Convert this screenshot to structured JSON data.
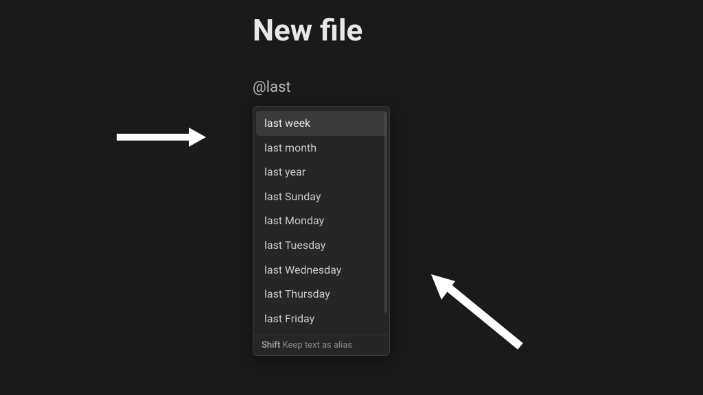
{
  "title": "New file",
  "query": "@last",
  "suggestions": [
    {
      "label": "last week",
      "selected": true
    },
    {
      "label": "last month",
      "selected": false
    },
    {
      "label": "last year",
      "selected": false
    },
    {
      "label": "last Sunday",
      "selected": false
    },
    {
      "label": "last Monday",
      "selected": false
    },
    {
      "label": "last Tuesday",
      "selected": false
    },
    {
      "label": "last Wednesday",
      "selected": false
    },
    {
      "label": "last Thursday",
      "selected": false
    },
    {
      "label": "last Friday",
      "selected": false
    }
  ],
  "footer": {
    "key": "Shift",
    "hint": "Keep text as alias"
  }
}
